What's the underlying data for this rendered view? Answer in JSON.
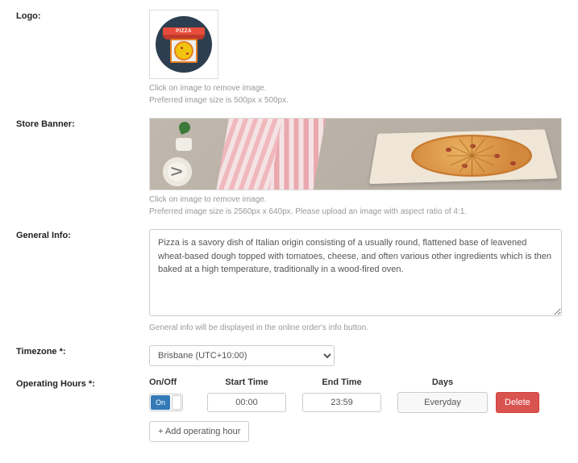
{
  "logo": {
    "label": "Logo:",
    "sign_text": "PIZZA",
    "help_line1": "Click on image to remove image.",
    "help_line2": "Preferred image size is 500px x 500px."
  },
  "banner": {
    "label": "Store Banner:",
    "help_line1": "Click on image to remove image.",
    "help_line2": "Preferred image size is 2560px x 640px. Please upload an image with aspect ratio of 4:1."
  },
  "general": {
    "label": "General Info:",
    "value": "Pizza is a savory dish of Italian origin consisting of a usually round, flattened base of leavened wheat-based dough topped with tomatoes, cheese, and often various other ingredients which is then baked at a high temperature, traditionally in a wood-fired oven.",
    "help": "General info will be displayed in the online order's info button."
  },
  "timezone": {
    "label": "Timezone *:",
    "value": "Brisbane (UTC+10:00)"
  },
  "hours": {
    "label": "Operating Hours *:",
    "header": {
      "onoff": "On/Off",
      "start": "Start Time",
      "end": "End Time",
      "days": "Days"
    },
    "row": {
      "switch_on_label": "On",
      "start": "00:00",
      "end": "23:59",
      "days": "Everyday",
      "delete": "Delete"
    },
    "add_button": "+ Add operating hour"
  }
}
